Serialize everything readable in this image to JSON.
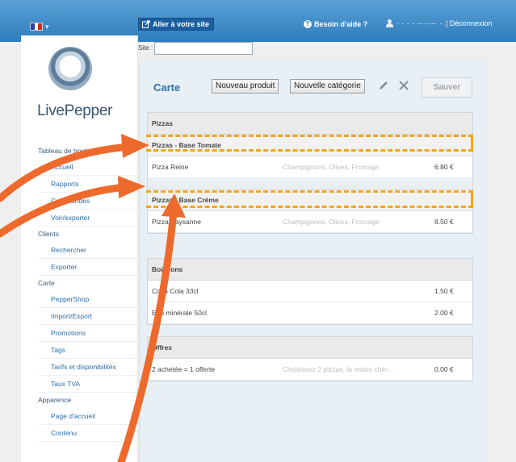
{
  "topbar": {
    "visit_site": "Aller à votre site",
    "help": "Besoin d'aide ?",
    "user_name": "- - - - ------- -",
    "logout": "| Déconnexion"
  },
  "site": {
    "label": "Site :",
    "value": ""
  },
  "logo": {
    "text": "LivePepper"
  },
  "sidebar": {
    "groups": [
      {
        "label": "Tableau de bord",
        "items": [
          "Accueil",
          "Rapports",
          "Commandes",
          "Voir/exporter"
        ]
      },
      {
        "label": "Clients",
        "items": [
          "Rechercher",
          "Exporter"
        ]
      },
      {
        "label": "Carte",
        "items": [
          "PepperShop",
          "Import/Export",
          "Promotions",
          "Tags",
          "Tarifs et disponibilités",
          "Taux TVA"
        ]
      },
      {
        "label": "Apparence",
        "items": [
          "Page d'accueil",
          "Contenu"
        ]
      }
    ]
  },
  "main": {
    "title": "Carte",
    "new_product": "Nouveau produit",
    "new_category": "Nouvelle catégorie",
    "save": "Sauver"
  },
  "menu": {
    "pizzas": {
      "title": "Pizzas",
      "sub1": "Pizzas - Base Tomate",
      "item1": {
        "name": "Pizza Reine",
        "desc": "Champignons, Olives, Fromage",
        "price": "6.80 €"
      },
      "sub2": "Pizzas - Base Crème",
      "item2": {
        "name": "Pizza Paysanne",
        "desc": "Champignons, Olives, Fromage",
        "price": "8.50 €"
      }
    },
    "boissons": {
      "title": "Boissons",
      "item1": {
        "name": "Coca Cola 33cl",
        "desc": "",
        "price": "1.50 €"
      },
      "item2": {
        "name": "Eau minérale 50cl",
        "desc": "",
        "price": "2.00 €"
      }
    },
    "offres": {
      "title": "Offres",
      "item1": {
        "name": "2 achetée = 1 offerte",
        "desc": "Choisissez 2 pizzas, la moins chèr...",
        "price": "0.00 €"
      }
    }
  },
  "colors": {
    "highlight": "#f5a51b",
    "arrow": "#ee6a2c",
    "topbar": "#3a87c6",
    "link": "#2d6da8"
  }
}
